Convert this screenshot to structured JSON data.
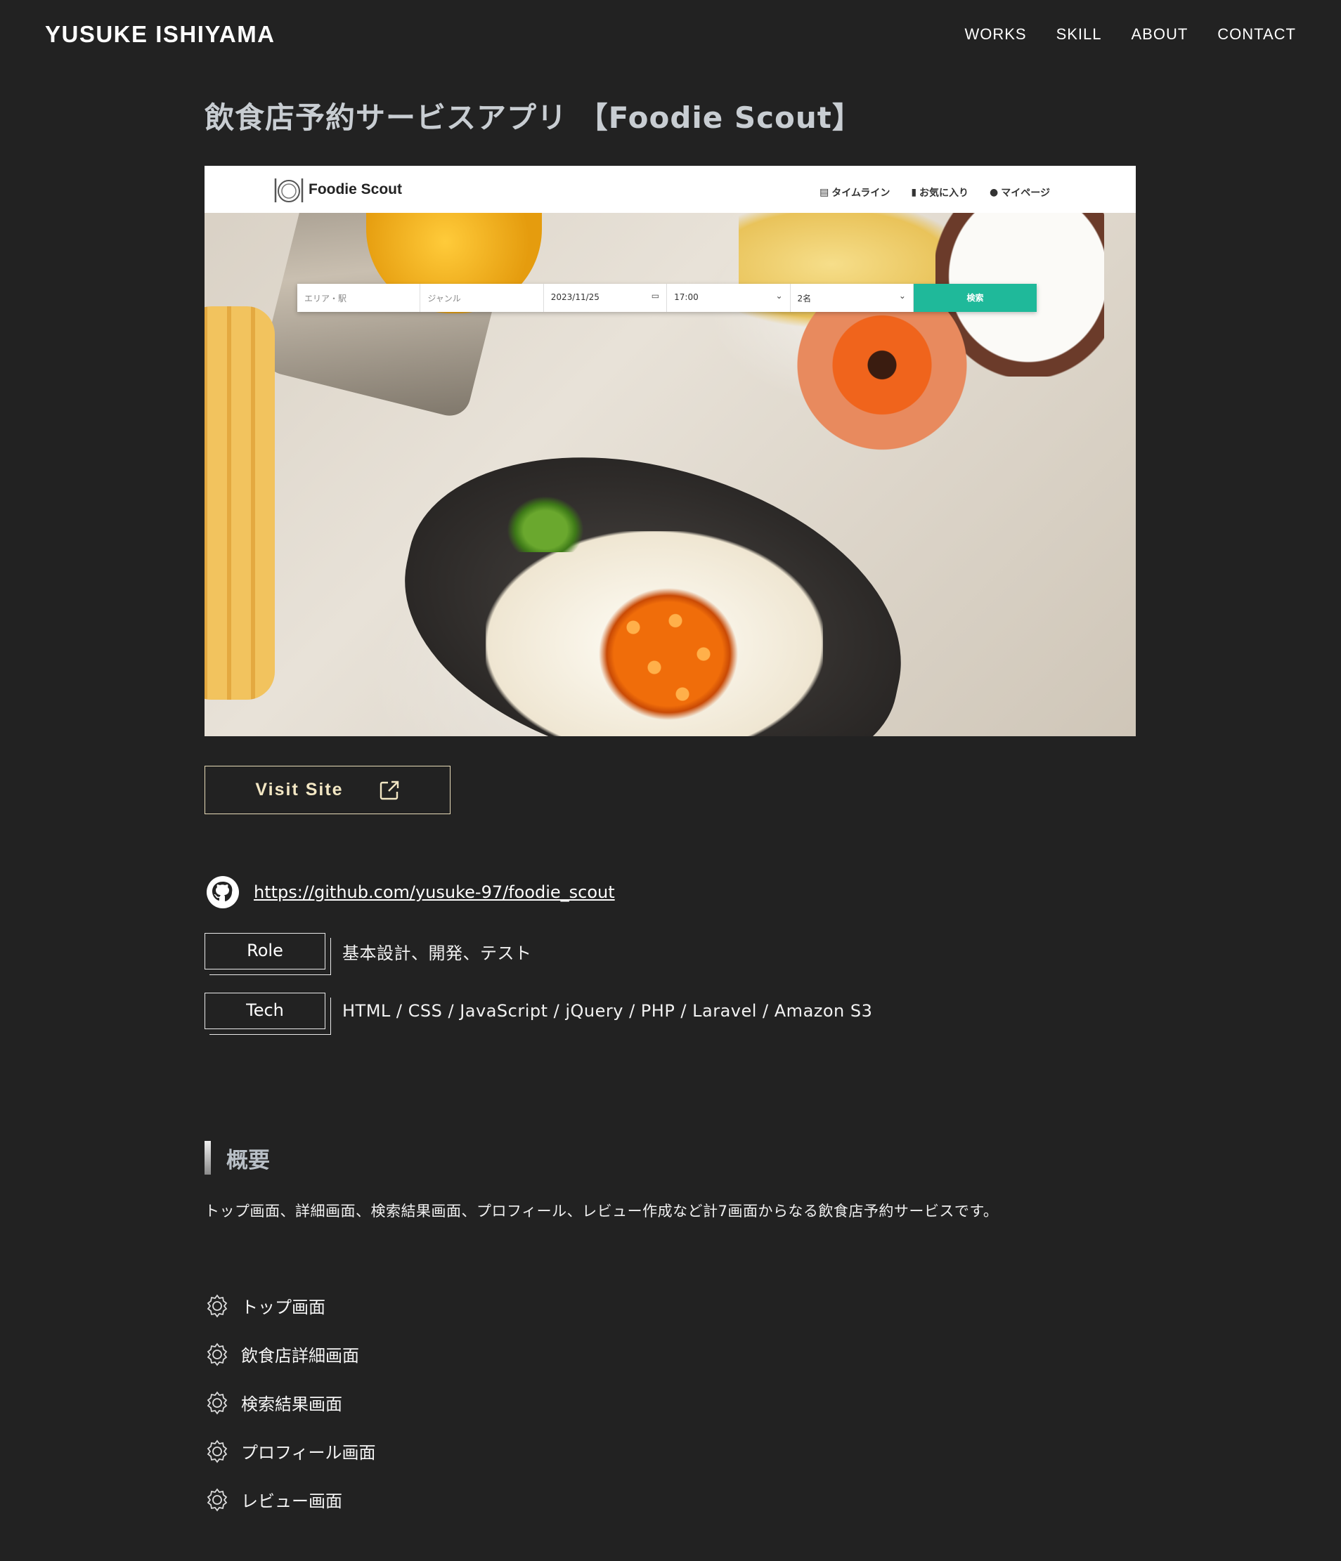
{
  "header": {
    "logo": "YUSUKE ISHIYAMA",
    "nav": [
      "WORKS",
      "SKILL",
      "ABOUT",
      "CONTACT"
    ]
  },
  "page_title": "飲食店予約サービスアプリ 【Foodie Scout】",
  "screenshot": {
    "logo": "Foodie Scout",
    "nav": [
      "タイムライン",
      "お気に入り",
      "マイページ"
    ],
    "search": {
      "area_placeholder": "エリア・駅",
      "genre_placeholder": "ジャンル",
      "date": "2023/11/25",
      "time": "17:00",
      "people": "2名",
      "button": "検索"
    }
  },
  "visit_button": "Visit Site",
  "github_url": "https://github.com/yusuke-97/foodie_scout",
  "role": {
    "label": "Role",
    "value": "基本設計、開発、テスト"
  },
  "tech": {
    "label": "Tech",
    "value": "HTML / CSS / JavaScript / jQuery / PHP / Laravel / Amazon S3"
  },
  "overview": {
    "title": "概要",
    "text": "トップ画面、詳細画面、検索結果画面、プロフィール、レビュー作成など計7画面からなる飲食店予約サービスです。"
  },
  "features": [
    "トップ画面",
    "飲食店詳細画面",
    "検索結果画面",
    "プロフィール画面",
    "レビュー画面"
  ],
  "colors": {
    "background": "#222222",
    "accent_button": "#1fb99a",
    "visit_border": "#e9dcb8"
  }
}
